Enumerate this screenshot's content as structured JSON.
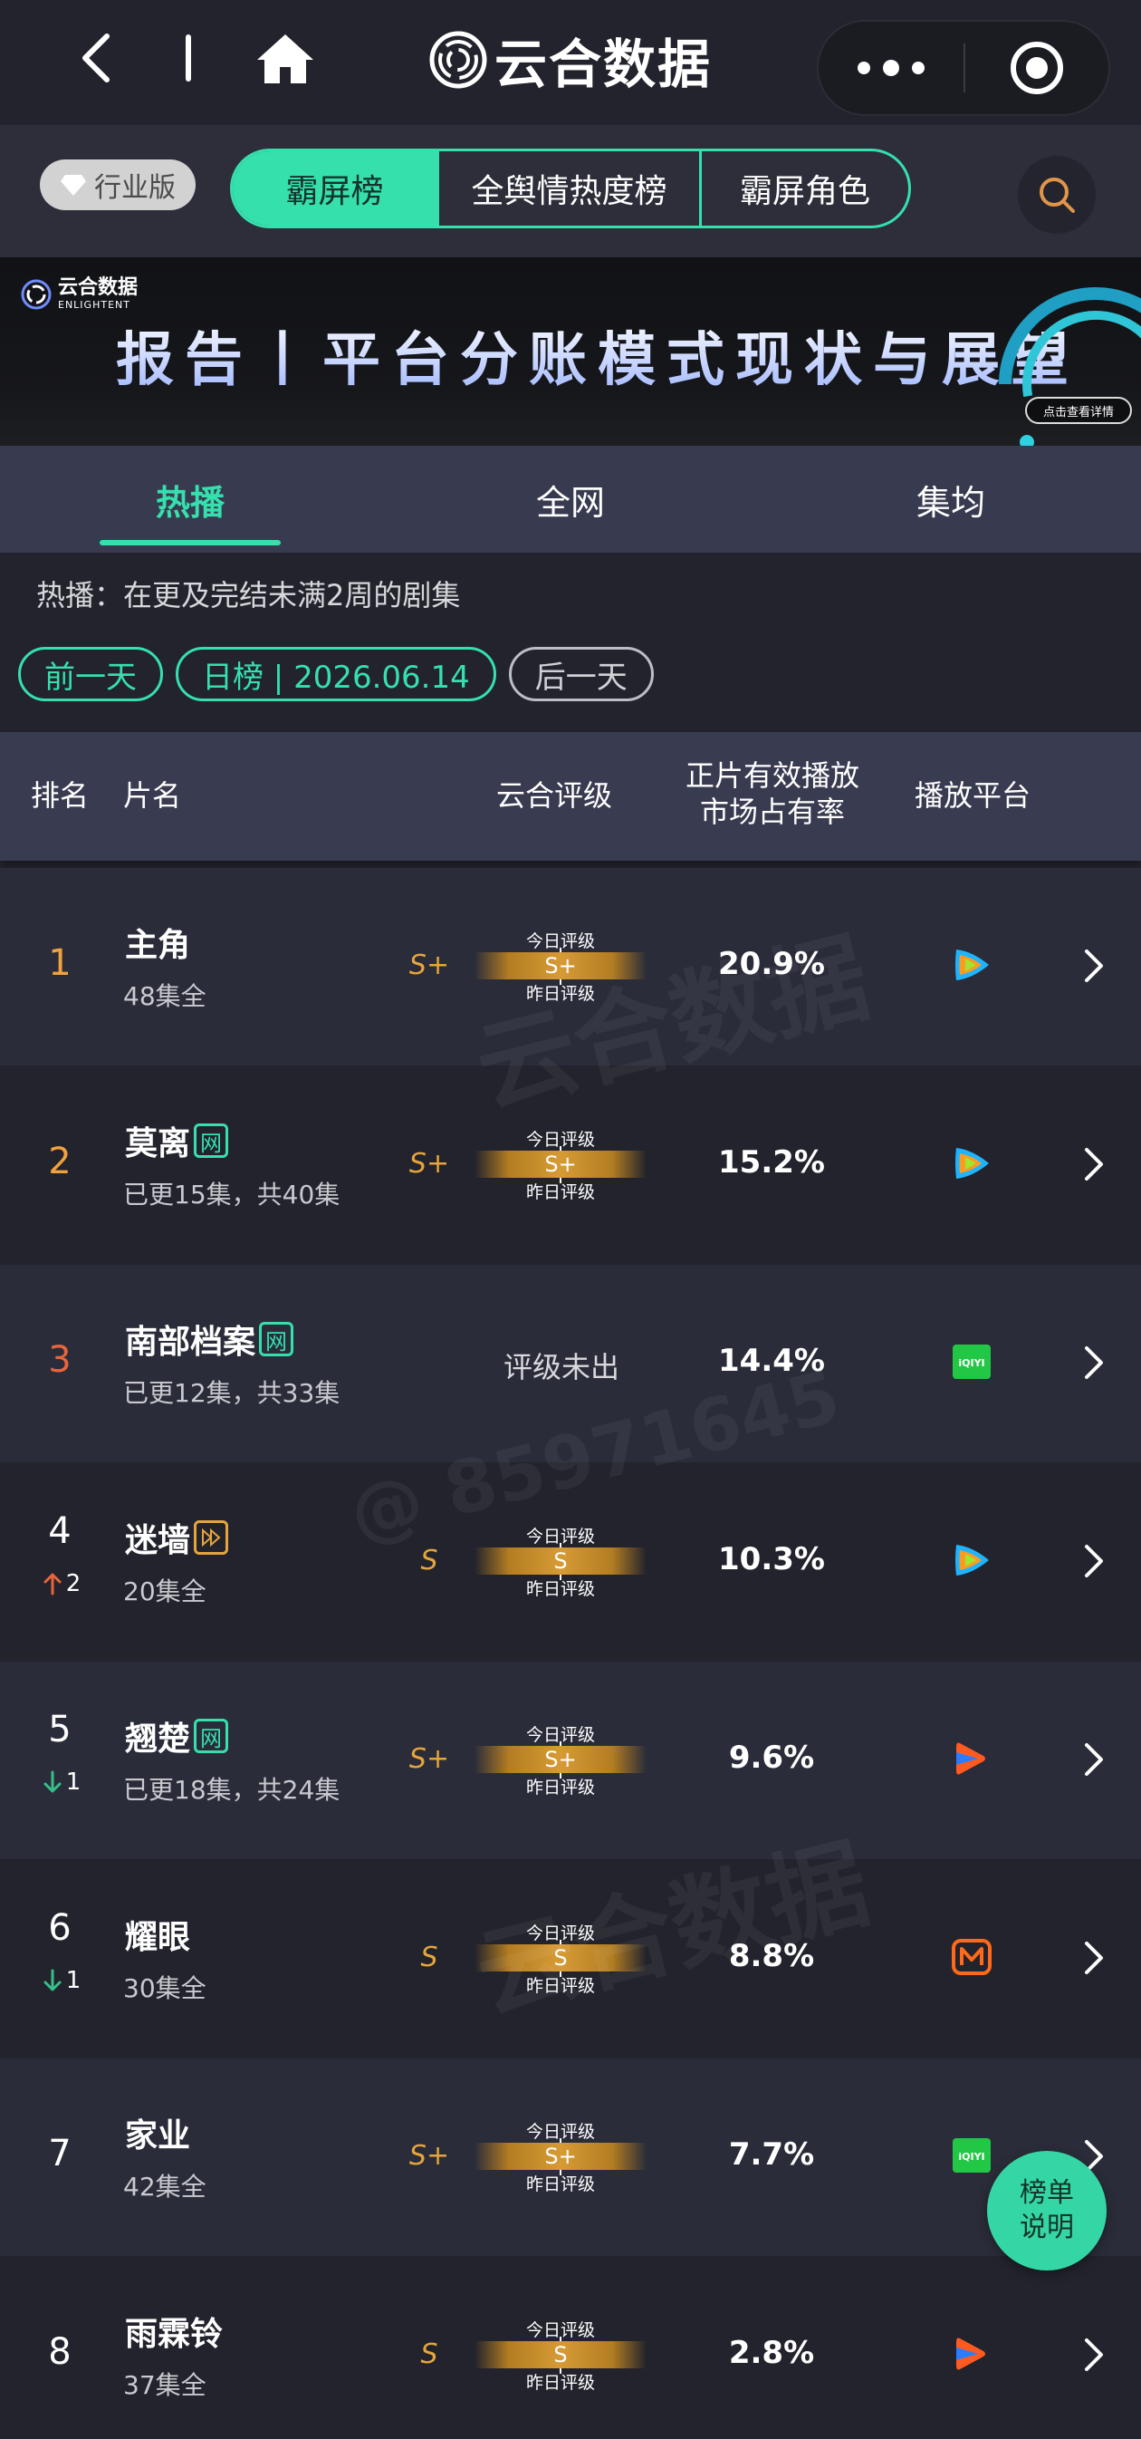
{
  "brand": {
    "name": "云合数据"
  },
  "filters": {
    "industry_label": "行业版",
    "segments": [
      {
        "label": "霸屏榜",
        "active": true
      },
      {
        "label": "全舆情热度榜",
        "active": false
      },
      {
        "label": "霸屏角色",
        "active": false
      }
    ]
  },
  "banner": {
    "logo_cn": "云合数据",
    "logo_en": "ENLIGHTENT",
    "title": "报告丨平台分账模式现状与展望",
    "cta": "点击查看详情"
  },
  "tabs": [
    {
      "label": "热播",
      "active": true
    },
    {
      "label": "全网",
      "active": false
    },
    {
      "label": "集均",
      "active": false
    }
  ],
  "note": "热播：在更及完结未满2周的剧集",
  "date_nav": {
    "prev": "前一天",
    "current": "日榜 | 2026.06.14",
    "next": "后一天"
  },
  "table": {
    "headers": {
      "rank": "排名",
      "title": "片名",
      "grade": "云合评级",
      "share_line1": "正片有效播放",
      "share_line2": "市场占有率",
      "platform": "播放平台"
    },
    "grade_labels": {
      "today": "今日评级",
      "yesterday": "昨日评级",
      "none": "评级未出"
    },
    "rows": [
      {
        "rank": "1",
        "title": "主角",
        "badge": "",
        "status": "48集全",
        "grade_mark": "S+",
        "grade": "S+",
        "share": "20.9%",
        "platform": "tencent-video-icon",
        "trend": "",
        "trend_value": ""
      },
      {
        "rank": "2",
        "title": "莫离",
        "badge": "网",
        "status": "已更15集，共40集",
        "grade_mark": "S+",
        "grade": "S+",
        "share": "15.2%",
        "platform": "tencent-video-icon",
        "trend": "",
        "trend_value": ""
      },
      {
        "rank": "3",
        "title": "南部档案",
        "badge": "网",
        "status": "已更12集，共33集",
        "grade_mark": "",
        "grade": "",
        "share": "14.4%",
        "platform": "iqiyi-icon",
        "trend": "",
        "trend_value": ""
      },
      {
        "rank": "4",
        "title": "迷墙",
        "badge": "play",
        "status": "20集全",
        "grade_mark": "S",
        "grade": "S",
        "share": "10.3%",
        "platform": "tencent-video-icon",
        "trend": "up",
        "trend_value": "2"
      },
      {
        "rank": "5",
        "title": "翘楚",
        "badge": "网",
        "status": "已更18集，共24集",
        "grade_mark": "S+",
        "grade": "S+",
        "share": "9.6%",
        "platform": "youku-icon",
        "trend": "down",
        "trend_value": "1"
      },
      {
        "rank": "6",
        "title": "耀眼",
        "badge": "",
        "status": "30集全",
        "grade_mark": "S",
        "grade": "S",
        "share": "8.8%",
        "platform": "mango-tv-icon",
        "trend": "down",
        "trend_value": "1"
      },
      {
        "rank": "7",
        "title": "家业",
        "badge": "",
        "status": "42集全",
        "grade_mark": "S+",
        "grade": "S+",
        "share": "7.7%",
        "platform": "iqiyi-icon",
        "trend": "",
        "trend_value": ""
      },
      {
        "rank": "8",
        "title": "雨霖铃",
        "badge": "",
        "status": "37集全",
        "grade_mark": "S",
        "grade": "S",
        "share": "2.8%",
        "platform": "youku-icon",
        "trend": "",
        "trend_value": ""
      }
    ]
  },
  "float_help": "榜单说明",
  "watermarks": {
    "brand_cn": "云合数据",
    "brand_en": "ENLIGHTENT",
    "user_id": "@ 85971645"
  },
  "colors": {
    "accent": "#35e0ad",
    "gold": "#e6a53c",
    "rank_top": "#f0a23c",
    "up": "#e8643c",
    "down": "#35c08a"
  }
}
